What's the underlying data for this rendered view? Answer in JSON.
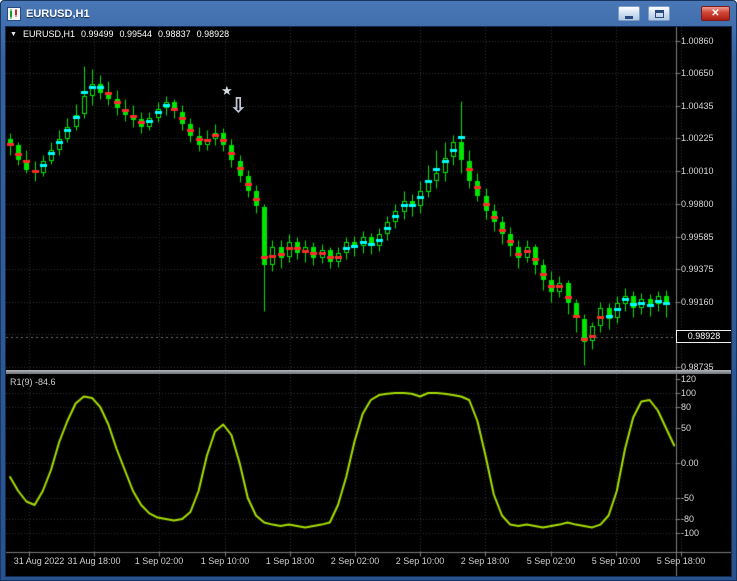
{
  "window": {
    "title": "EURUSD,H1",
    "icons": {
      "close": "✕"
    }
  },
  "chart": {
    "symbol_line": {
      "marker": "▼",
      "symbol": "EURUSD,H1",
      "open": "0.99499",
      "high": "0.99544",
      "low": "0.98837",
      "close": "0.98928"
    },
    "current_price_badge": "0.98928",
    "price_axis_labels": [
      "1.00860",
      "1.00650",
      "1.00435",
      "1.00225",
      "1.00010",
      "0.99800",
      "0.99585",
      "0.99375",
      "0.99160",
      "0.98735"
    ],
    "objects": {
      "star": "★",
      "arrow_down": "⇩"
    }
  },
  "indicator": {
    "label": "R1(9) -84.6",
    "name": "R1",
    "period": 9,
    "value": -84.6,
    "axis_labels": [
      "120",
      "100",
      "80",
      "50",
      "0.00",
      "-50",
      "-80",
      "-100"
    ]
  },
  "colors": {
    "background": "#000000",
    "grid": "#303030",
    "candle": "#00e600",
    "up_dash": "#00ffff",
    "down_dash": "#ff2a2a",
    "oscillator_line": "#a8e000",
    "axis_line": "#7d7d7d",
    "bid_line": "#6f6f6f",
    "axis_text": "#d8d8d8"
  },
  "chart_data": {
    "type": "candlestick",
    "symbol": "EURUSD",
    "timeframe": "H1",
    "price_range": [
      0.98735,
      1.0086
    ],
    "current_price": 0.98928,
    "x_tick_labels": [
      "31 Aug 2022",
      "31 Aug 18:00",
      "1 Sep 02:00",
      "1 Sep 10:00",
      "1 Sep 18:00",
      "2 Sep 02:00",
      "2 Sep 10:00",
      "2 Sep 18:00",
      "5 Sep 02:00",
      "5 Sep 10:00",
      "5 Sep 18:00"
    ],
    "grid_prices": [
      1.0086,
      1.0065,
      1.00435,
      1.00225,
      1.0001,
      0.998,
      0.99585,
      0.99375,
      0.9916,
      0.9895,
      0.98735
    ],
    "candles": [
      [
        1.0022,
        1.0026,
        1.0012,
        1.0018,
        "d"
      ],
      [
        1.0018,
        1.002,
        1.0005,
        1.0008,
        "d"
      ],
      [
        1.0008,
        1.0015,
        1.0,
        1.0002,
        "d"
      ],
      [
        1.0002,
        1.0008,
        0.9995,
        1.0,
        "d"
      ],
      [
        1.0,
        1.0012,
        0.9998,
        1.0008,
        "u"
      ],
      [
        1.0008,
        1.002,
        1.0006,
        1.0015,
        "u"
      ],
      [
        1.0015,
        1.0028,
        1.0012,
        1.0022,
        "u"
      ],
      [
        1.0022,
        1.0036,
        1.002,
        1.003,
        "u"
      ],
      [
        1.003,
        1.0045,
        1.0028,
        1.0038,
        "u"
      ],
      [
        1.0038,
        1.007,
        1.0036,
        1.005,
        "u"
      ],
      [
        1.005,
        1.0068,
        1.0044,
        1.0058,
        "u"
      ],
      [
        1.0058,
        1.0064,
        1.0048,
        1.0052,
        "u"
      ],
      [
        1.0052,
        1.006,
        1.0044,
        1.0048,
        "d"
      ],
      [
        1.0048,
        1.0054,
        1.0038,
        1.0042,
        "d"
      ],
      [
        1.0042,
        1.0048,
        1.0034,
        1.0038,
        "d"
      ],
      [
        1.0038,
        1.0044,
        1.003,
        1.0035,
        "d"
      ],
      [
        1.0035,
        1.004,
        1.0026,
        1.003,
        "d"
      ],
      [
        1.003,
        1.004,
        1.0028,
        1.0036,
        "u"
      ],
      [
        1.0036,
        1.0046,
        1.0033,
        1.0042,
        "u"
      ],
      [
        1.0042,
        1.005,
        1.0038,
        1.0046,
        "u"
      ],
      [
        1.0046,
        1.0048,
        1.0036,
        1.004,
        "d"
      ],
      [
        1.004,
        1.0044,
        1.0028,
        1.0032,
        "d"
      ],
      [
        1.0032,
        1.0036,
        1.002,
        1.0024,
        "d"
      ],
      [
        1.0024,
        1.003,
        1.0014,
        1.0018,
        "d"
      ],
      [
        1.0018,
        1.0028,
        1.0015,
        1.0022,
        "d"
      ],
      [
        1.0022,
        1.0032,
        1.0018,
        1.0026,
        "d"
      ],
      [
        1.0026,
        1.0029,
        1.0014,
        1.0018,
        "d"
      ],
      [
        1.0018,
        1.0022,
        1.0004,
        1.0008,
        "d"
      ],
      [
        1.0008,
        1.0012,
        0.9994,
        0.9998,
        "d"
      ],
      [
        0.9998,
        1.0002,
        0.9984,
        0.9988,
        "d"
      ],
      [
        0.9988,
        0.9992,
        0.9974,
        0.9978,
        "d"
      ],
      [
        0.9978,
        0.998,
        0.991,
        0.994,
        "d"
      ],
      [
        0.994,
        0.9956,
        0.9936,
        0.9952,
        "d"
      ],
      [
        0.9952,
        0.9956,
        0.9938,
        0.9945,
        "d"
      ],
      [
        0.9945,
        0.996,
        0.9942,
        0.9955,
        "d"
      ],
      [
        0.9955,
        0.9958,
        0.9944,
        0.9948,
        "d"
      ],
      [
        0.9948,
        0.9956,
        0.9942,
        0.9952,
        "d"
      ],
      [
        0.9952,
        0.9955,
        0.994,
        0.9945,
        "d"
      ],
      [
        0.9945,
        0.9954,
        0.9941,
        0.995,
        "d"
      ],
      [
        0.995,
        0.9952,
        0.9938,
        0.9942,
        "d"
      ],
      [
        0.9942,
        0.9952,
        0.9939,
        0.9948,
        "d"
      ],
      [
        0.9948,
        0.9958,
        0.9944,
        0.9955,
        "u"
      ],
      [
        0.9955,
        0.9959,
        0.9946,
        0.9952,
        "u"
      ],
      [
        0.9952,
        0.9962,
        0.9948,
        0.9958,
        "u"
      ],
      [
        0.9958,
        0.9961,
        0.9947,
        0.9952,
        "u"
      ],
      [
        0.9952,
        0.9964,
        0.9949,
        0.996,
        "u"
      ],
      [
        0.996,
        0.9972,
        0.9956,
        0.9968,
        "u"
      ],
      [
        0.9968,
        0.998,
        0.9964,
        0.9975,
        "u"
      ],
      [
        0.9975,
        0.9988,
        0.997,
        0.9982,
        "u"
      ],
      [
        0.9982,
        0.9986,
        0.9972,
        0.9978,
        "u"
      ],
      [
        0.9978,
        0.9995,
        0.9974,
        0.9988,
        "u"
      ],
      [
        0.9988,
        1.0005,
        0.9984,
        0.9995,
        "u"
      ],
      [
        0.9995,
        1.0015,
        0.999,
        1.0,
        "u"
      ],
      [
        1.0,
        1.002,
        0.9995,
        1.001,
        "u"
      ],
      [
        1.001,
        1.0025,
        1.0005,
        1.002,
        "u"
      ],
      [
        1.002,
        1.0047,
        1.0,
        1.0008,
        "u"
      ],
      [
        1.0008,
        1.0015,
        0.999,
        0.9995,
        "d"
      ],
      [
        0.9995,
        1.0,
        0.9982,
        0.9985,
        "d"
      ],
      [
        0.9985,
        0.999,
        0.997,
        0.9975,
        "d"
      ],
      [
        0.9975,
        0.998,
        0.9962,
        0.9968,
        "d"
      ],
      [
        0.9968,
        0.9972,
        0.9954,
        0.996,
        "d"
      ],
      [
        0.996,
        0.9965,
        0.9946,
        0.9952,
        "d"
      ],
      [
        0.9952,
        0.9956,
        0.9938,
        0.9945,
        "d"
      ],
      [
        0.9945,
        0.9956,
        0.9942,
        0.9952,
        "d"
      ],
      [
        0.9952,
        0.9954,
        0.9934,
        0.994,
        "d"
      ],
      [
        0.994,
        0.9944,
        0.9924,
        0.993,
        "d"
      ],
      [
        0.993,
        0.9936,
        0.9916,
        0.9922,
        "d"
      ],
      [
        0.9922,
        0.9933,
        0.9919,
        0.9928,
        "d"
      ],
      [
        0.9928,
        0.993,
        0.9908,
        0.9915,
        "d"
      ],
      [
        0.9915,
        0.9918,
        0.9896,
        0.9905,
        "d"
      ],
      [
        0.9905,
        0.9908,
        0.9875,
        0.989,
        "d"
      ],
      [
        0.989,
        0.9903,
        0.9885,
        0.99,
        "d"
      ],
      [
        0.99,
        0.9916,
        0.9896,
        0.9912,
        "d"
      ],
      [
        0.9912,
        0.9915,
        0.9898,
        0.9905,
        "u"
      ],
      [
        0.9905,
        0.992,
        0.9902,
        0.9915,
        "u"
      ],
      [
        0.9915,
        0.9925,
        0.991,
        0.992,
        "u"
      ],
      [
        0.992,
        0.9923,
        0.9906,
        0.9912,
        "u"
      ],
      [
        0.9912,
        0.9922,
        0.9908,
        0.9918,
        "u"
      ],
      [
        0.9918,
        0.9921,
        0.9907,
        0.9915,
        "u"
      ],
      [
        0.9915,
        0.9923,
        0.991,
        0.992,
        "u"
      ],
      [
        0.992,
        0.9924,
        0.9906,
        0.9916,
        "u"
      ]
    ],
    "oscillator": {
      "name": "R1(9)",
      "current_value": -84.6,
      "range": [
        -100,
        120
      ],
      "levels": [
        100,
        80,
        50,
        0,
        -50,
        -80,
        -100
      ],
      "values": [
        -20,
        -40,
        -55,
        -60,
        -40,
        -10,
        30,
        60,
        85,
        95,
        93,
        80,
        55,
        20,
        -10,
        -40,
        -60,
        -72,
        -78,
        -80,
        -82,
        -80,
        -70,
        -40,
        10,
        45,
        55,
        40,
        0,
        -50,
        -75,
        -85,
        -88,
        -90,
        -88,
        -90,
        -92,
        -90,
        -88,
        -85,
        -60,
        -20,
        30,
        70,
        90,
        97,
        99,
        100,
        100,
        99,
        95,
        100,
        100,
        99,
        97,
        95,
        90,
        60,
        10,
        -45,
        -75,
        -88,
        -90,
        -88,
        -90,
        -92,
        -90,
        -88,
        -85,
        -88,
        -90,
        -92,
        -88,
        -75,
        -40,
        20,
        65,
        88,
        90,
        75,
        50,
        25
      ]
    }
  }
}
